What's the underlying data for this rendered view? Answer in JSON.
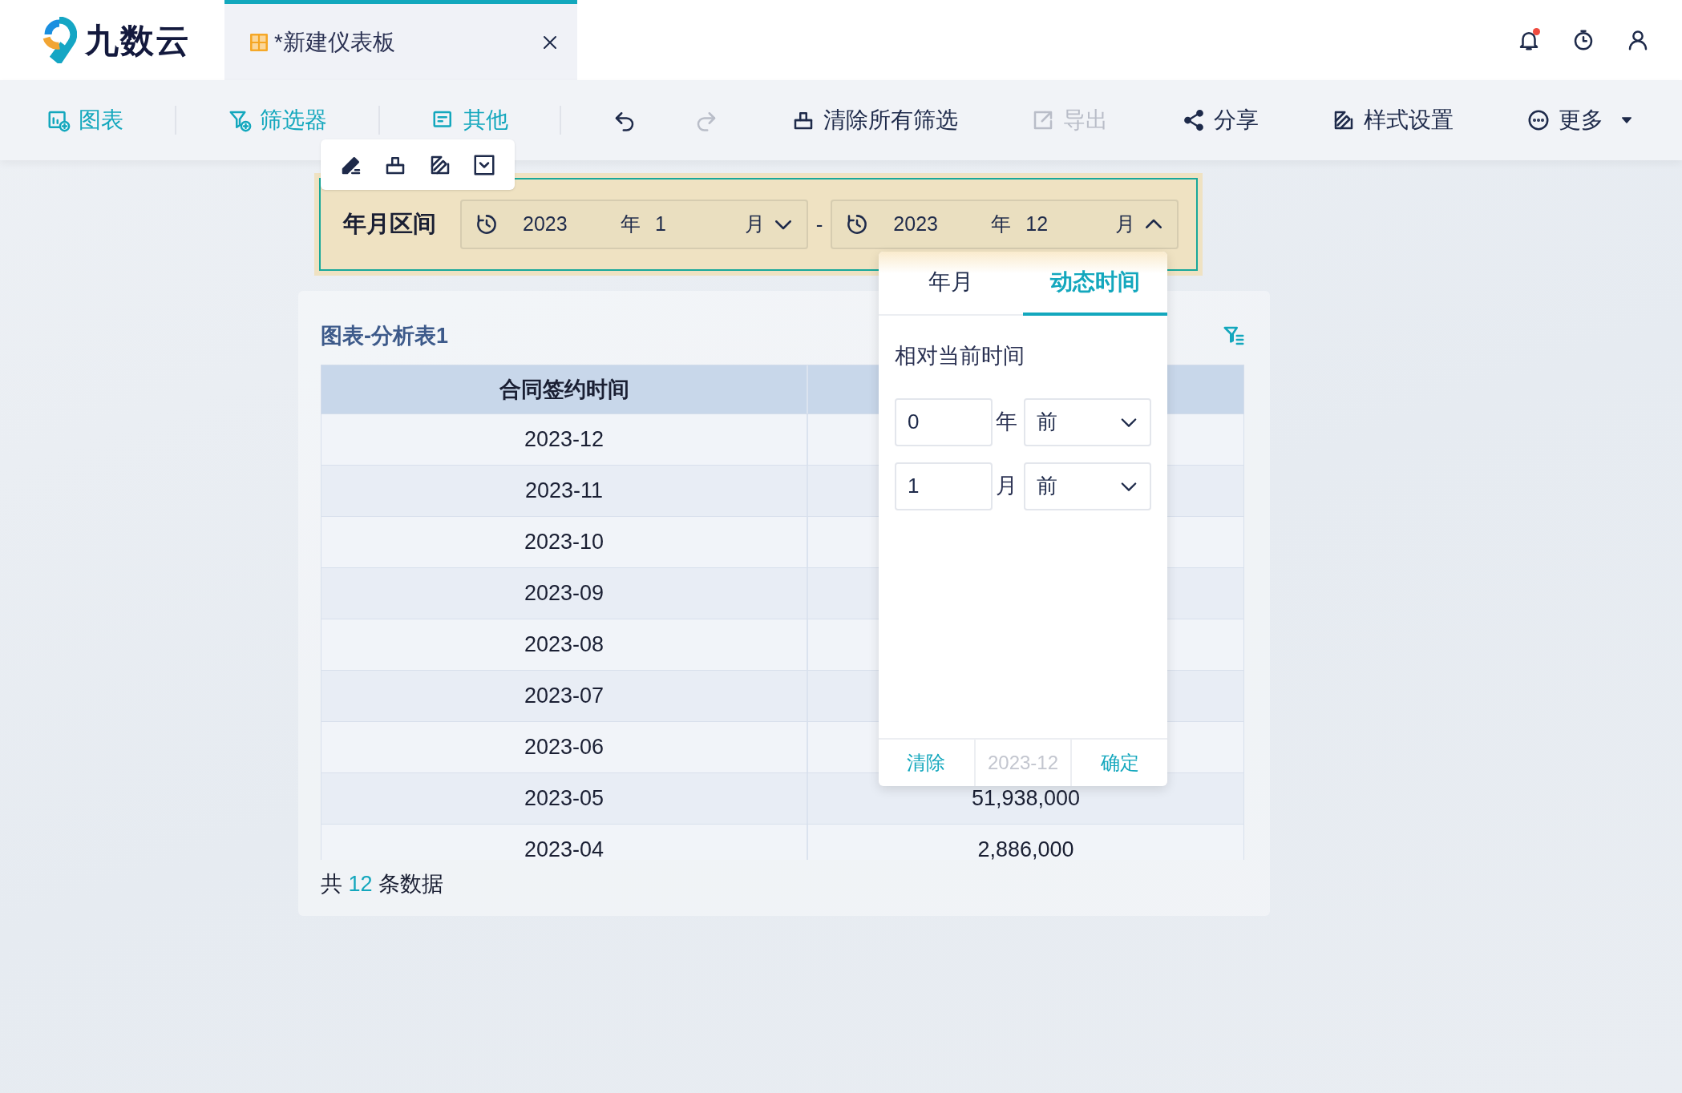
{
  "app": {
    "logo_text": "九数云"
  },
  "tabs": [
    {
      "label": "*新建仪表板",
      "selected": true
    }
  ],
  "header_icons": [
    {
      "kind": "bell",
      "badge": true
    },
    {
      "kind": "timer",
      "badge": false
    },
    {
      "kind": "user",
      "badge": false
    }
  ],
  "toolbar": [
    {
      "kind": "insert",
      "label": "图表",
      "disabled": false
    },
    {
      "kind": "insert",
      "label": "筛选器",
      "disabled": false
    },
    {
      "kind": "insert",
      "label": "其他",
      "disabled": false
    },
    {
      "kind": "undo",
      "disabled": false
    },
    {
      "kind": "redo",
      "disabled": true
    },
    {
      "kind": "clear",
      "label": "清除所有筛选",
      "disabled": false
    },
    {
      "kind": "export",
      "label": "导出",
      "disabled": true
    },
    {
      "kind": "share",
      "label": "分享",
      "disabled": false
    },
    {
      "kind": "style",
      "label": "样式设置",
      "disabled": false
    },
    {
      "kind": "more",
      "label": "更多",
      "disabled": false
    }
  ],
  "widget_toolbar": [
    {
      "kind": "edit"
    },
    {
      "kind": "clear"
    },
    {
      "kind": "style"
    },
    {
      "kind": "check"
    }
  ],
  "filter": {
    "label": "年月区间",
    "separator": "-",
    "start": {
      "year": "2023",
      "year_unit": "年",
      "month": "1",
      "month_unit": "月",
      "expanded": false
    },
    "end": {
      "year": "2023",
      "year_unit": "年",
      "month": "12",
      "month_unit": "月",
      "expanded": true
    }
  },
  "table_card": {
    "title": "图表-分析表1",
    "columns": [
      "合同签约时间"
    ],
    "rows": [
      {
        "column_1": "2023-12"
      },
      {
        "column_1": "2023-11"
      },
      {
        "column_1": "2023-10"
      },
      {
        "column_1": "2023-09"
      },
      {
        "column_1": "2023-08"
      },
      {
        "column_1": "2023-07"
      },
      {
        "column_1": "2023-06"
      },
      {
        "column_1": "2023-05",
        "column_2": "51,938,000"
      },
      {
        "column_1": "2023-04",
        "column_2": "2,886,000"
      }
    ],
    "footer": "共 **12** 条数据"
  },
  "popup": {
    "tabs": [
      {
        "label": "年月",
        "selected": false
      },
      {
        "label": "动态时间",
        "selected": true
      }
    ],
    "label": "相对当前时间",
    "rows": [
      {
        "value": "0",
        "unit": "年",
        "direction": "前"
      },
      {
        "value": "1",
        "unit": "月",
        "direction": "前"
      }
    ],
    "footer": {
      "clear": "清除",
      "current": "2023-12",
      "confirm": "确定"
    }
  }
}
